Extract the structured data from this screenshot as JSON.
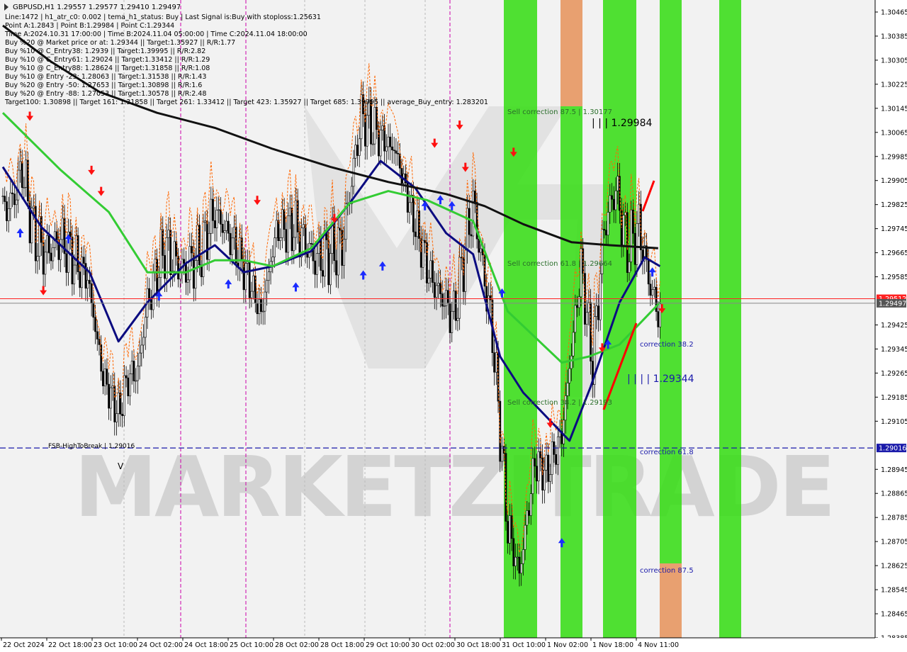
{
  "header": {
    "symbol": "GBPUSD,H1",
    "ohlc": "1.29557 1.29577 1.29410 1.29497",
    "info_lines": [
      "Line:1472 | h1_atr_c0: 0.002 | tema_h1_status: Buy | Last Signal is:Buy with stoploss:1.25631",
      "Point A:1.2843 | Point B:1.29984 | Point C:1.29344",
      "Time A:2024.10.31 17:00:00 | Time B:2024.11.04 05:00:00 | Time C:2024.11.04 18:00:00",
      "Buy %20 @ Market price or at: 1.29344 || Target:1.35927 || R/R:1.77",
      "Buy %10 @ C_Entry38: 1.2939 || Target:1.39995 || R/R:2.82",
      "Buy %10 @ C_Entry61: 1.29024 || Target:1.33412 || R/R:1.29",
      "Buy %10 @ C_Entry88: 1.28624 || Target:1.31858 || R/R:1.08",
      "Buy %10 @ Entry -23: 1.28063 || Target:1.31538 || R/R:1.43",
      "Buy %20 @ Entry -50: 1.27653 || Target:1.30898 || R/R:1.6",
      "Buy %20 @ Entry -88: 1.27053 || Target:1.30578 || R/R:2.48",
      "Target100: 1.30898 || Target 161: 1.31858 || Target 261: 1.33412 || Target 423: 1.35927 || Target 685: 1.39995 || average_Buy_entry: 1.283201"
    ]
  },
  "annotations": {
    "sell_875": "Sell correction 87.5 | 1.30177",
    "sell_618": "Sell correction 61.8 | 1.29664",
    "sell_382": "Sell correction 38.2 | 1.29193",
    "point_b": "| | | 1.29984",
    "point_c": "| | | | 1.29344",
    "corr_382": "correction 38.2",
    "corr_618": "correction 61.8",
    "corr_875": "correction 87.5",
    "fsb": "FSB-HighToBreak | 1.29016",
    "watermark": "MARKETZITRADE"
  },
  "colors": {
    "green_band": "#33dd11",
    "orange_band": "#e8a070",
    "ma_navy": "#0b0b80",
    "ma_green": "#33cc33",
    "ma_black": "#111111",
    "up_arrow": "#1a2bff",
    "down_arrow": "#ff1010",
    "fsb_line": "#1a1aaa",
    "price_line": "#ff2222",
    "current_line": "#888888"
  },
  "chart_data": {
    "type": "candlestick",
    "symbol": "GBPUSD",
    "timeframe": "H1",
    "ylim": [
      1.28385,
      1.30505
    ],
    "y_ticks": [
      1.30465,
      1.30385,
      1.30305,
      1.30225,
      1.30145,
      1.30065,
      1.29985,
      1.29905,
      1.29825,
      1.29745,
      1.29665,
      1.29585,
      1.29425,
      1.29345,
      1.29265,
      1.29185,
      1.29105,
      1.28945,
      1.28865,
      1.28785,
      1.28705,
      1.28625,
      1.28545,
      1.28465,
      1.28385
    ],
    "x_ticks": [
      "22 Oct 2024",
      "22 Oct 18:00",
      "23 Oct 10:00",
      "24 Oct 02:00",
      "24 Oct 18:00",
      "25 Oct 10:00",
      "28 Oct 02:00",
      "28 Oct 18:00",
      "29 Oct 10:00",
      "30 Oct 02:00",
      "30 Oct 18:00",
      "31 Oct 10:00",
      "1 Nov 02:00",
      "1 Nov 18:00",
      "4 Nov 11:00"
    ],
    "price_labels": {
      "red_level": "1.29512",
      "current": "1.29497",
      "fsb": "1.29016"
    },
    "levels": {
      "red_level": 1.29512,
      "current": 1.29497,
      "fsb": 1.29016
    },
    "anchors": [
      [
        0,
        1.298
      ],
      [
        6,
        1.2985
      ],
      [
        10,
        1.2995
      ],
      [
        16,
        1.2973
      ],
      [
        22,
        1.2966
      ],
      [
        30,
        1.2971
      ],
      [
        36,
        1.2965
      ],
      [
        44,
        1.2958
      ],
      [
        52,
        1.2925
      ],
      [
        60,
        1.2913
      ],
      [
        65,
        1.2925
      ],
      [
        70,
        1.2927
      ],
      [
        75,
        1.295
      ],
      [
        84,
        1.2968
      ],
      [
        94,
        1.296
      ],
      [
        102,
        1.2966
      ],
      [
        110,
        1.298
      ],
      [
        120,
        1.2969
      ],
      [
        128,
        1.2957
      ],
      [
        134,
        1.2946
      ],
      [
        142,
        1.2974
      ],
      [
        152,
        1.2975
      ],
      [
        162,
        1.2964
      ],
      [
        176,
        1.2969
      ],
      [
        186,
        1.3012
      ],
      [
        196,
        1.3005
      ],
      [
        204,
        1.3
      ],
      [
        212,
        1.298
      ],
      [
        222,
        1.2958
      ],
      [
        234,
        1.2945
      ],
      [
        244,
        1.2983
      ],
      [
        254,
        1.294
      ],
      [
        262,
        1.2875
      ],
      [
        268,
        1.286
      ],
      [
        276,
        1.2897
      ],
      [
        282,
        1.2893
      ],
      [
        290,
        1.2906
      ],
      [
        300,
        1.2962
      ],
      [
        306,
        1.293
      ],
      [
        312,
        1.2975
      ],
      [
        318,
        1.2988
      ],
      [
        324,
        1.2968
      ],
      [
        330,
        1.2975
      ],
      [
        336,
        1.2955
      ],
      [
        341,
        1.2945
      ]
    ],
    "series": [
      {
        "name": "MA blue",
        "values": [
          [
            0,
            1.2995
          ],
          [
            20,
            1.2975
          ],
          [
            45,
            1.296
          ],
          [
            60,
            1.2937
          ],
          [
            75,
            1.295
          ],
          [
            95,
            1.2963
          ],
          [
            110,
            1.2969
          ],
          [
            125,
            1.296
          ],
          [
            140,
            1.2962
          ],
          [
            160,
            1.2967
          ],
          [
            180,
            1.2983
          ],
          [
            196,
            1.2997
          ],
          [
            214,
            1.2988
          ],
          [
            230,
            1.2973
          ],
          [
            244,
            1.2966
          ],
          [
            258,
            1.2932
          ],
          [
            270,
            1.292
          ],
          [
            285,
            1.291
          ],
          [
            294,
            1.2904
          ],
          [
            305,
            1.2922
          ],
          [
            320,
            1.295
          ],
          [
            333,
            1.2965
          ],
          [
            341,
            1.2962
          ]
        ]
      },
      {
        "name": "MA green",
        "values": [
          [
            0,
            1.3013
          ],
          [
            30,
            1.2994
          ],
          [
            55,
            1.298
          ],
          [
            75,
            1.296
          ],
          [
            95,
            1.296
          ],
          [
            110,
            1.2964
          ],
          [
            125,
            1.2964
          ],
          [
            140,
            1.2962
          ],
          [
            160,
            1.2968
          ],
          [
            180,
            1.2983
          ],
          [
            200,
            1.2987
          ],
          [
            220,
            1.2984
          ],
          [
            244,
            1.2977
          ],
          [
            262,
            1.2947
          ],
          [
            290,
            1.293
          ],
          [
            304,
            1.2932
          ],
          [
            320,
            1.2936
          ],
          [
            341,
            1.295
          ]
        ]
      },
      {
        "name": "MA black",
        "values": [
          [
            0,
            1.3042
          ],
          [
            25,
            1.303
          ],
          [
            50,
            1.302
          ],
          [
            80,
            1.3013
          ],
          [
            110,
            1.3008
          ],
          [
            140,
            1.3001
          ],
          [
            170,
            1.2995
          ],
          [
            200,
            1.299
          ],
          [
            230,
            1.2986
          ],
          [
            250,
            1.2982
          ],
          [
            270,
            1.2976
          ],
          [
            295,
            1.297
          ],
          [
            315,
            1.2969
          ],
          [
            340,
            1.2968
          ]
        ]
      }
    ],
    "signals_up": [
      [
        9,
        1.2973
      ],
      [
        34,
        1.2971
      ],
      [
        81,
        1.2952
      ],
      [
        117,
        1.2956
      ],
      [
        152,
        1.2955
      ],
      [
        187,
        1.2959
      ],
      [
        197,
        1.2962
      ],
      [
        219,
        1.2982
      ],
      [
        227,
        1.2984
      ],
      [
        233,
        1.2982
      ],
      [
        259,
        1.2953
      ],
      [
        290,
        1.287
      ],
      [
        314,
        1.2936
      ],
      [
        337,
        1.296
      ]
    ],
    "signals_down": [
      [
        14,
        1.3012
      ],
      [
        21,
        1.2954
      ],
      [
        46,
        1.2994
      ],
      [
        51,
        1.2987
      ],
      [
        132,
        1.2984
      ],
      [
        172,
        1.2978
      ],
      [
        224,
        1.3003
      ],
      [
        237,
        1.3009
      ],
      [
        240,
        1.2995
      ],
      [
        265,
        1.3
      ],
      [
        284,
        1.291
      ],
      [
        311,
        1.2935
      ],
      [
        342,
        1.2948
      ]
    ]
  }
}
